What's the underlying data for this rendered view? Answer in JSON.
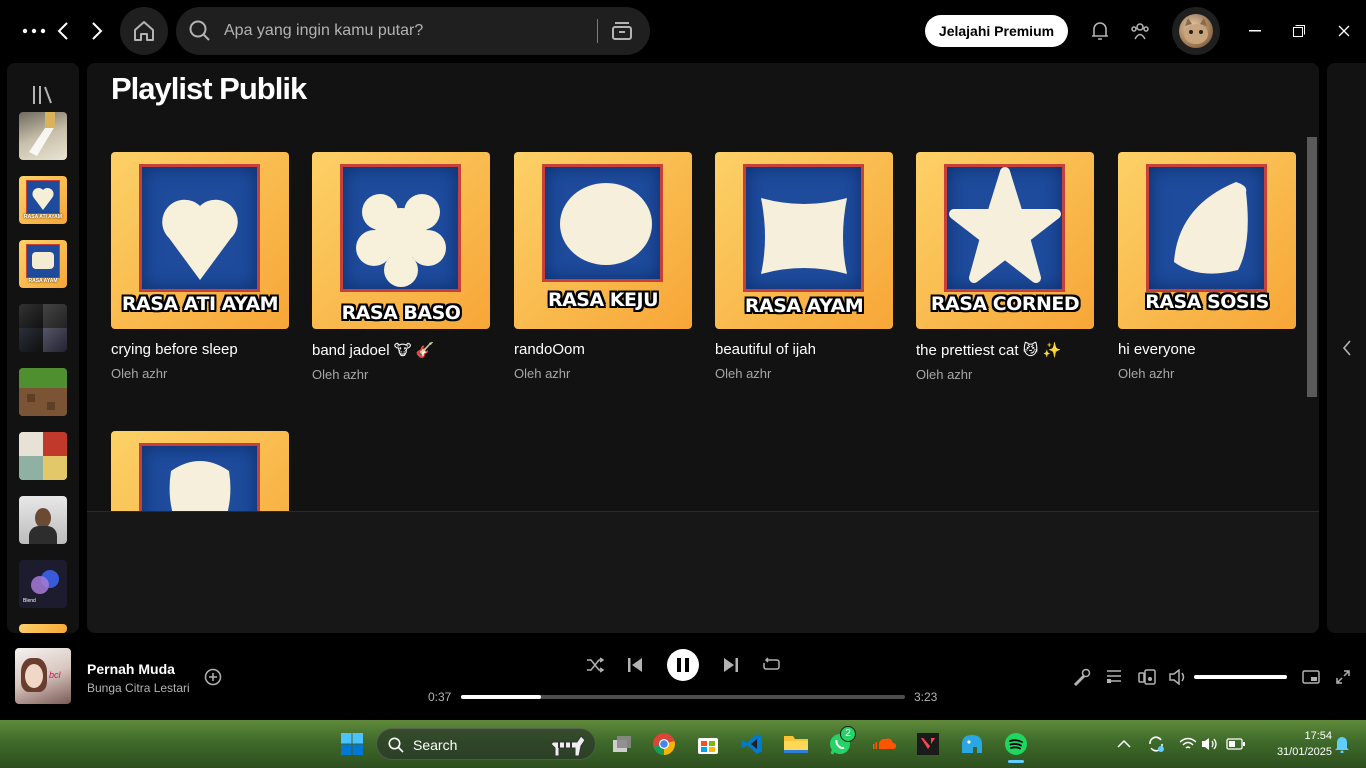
{
  "search": {
    "placeholder": "Apa yang ingin kamu putar?"
  },
  "header": {
    "premium_label": "Jelajahi Premium"
  },
  "section": {
    "title": "Playlist Publik"
  },
  "cards": [
    {
      "cover_label": "RASA ATI AYAM",
      "title": "crying before sleep",
      "owner": "Oleh azhr"
    },
    {
      "cover_label": "RASA BASO",
      "title": "band jadoel 🐮 🎸",
      "owner": "Oleh azhr"
    },
    {
      "cover_label": "RASA KEJU",
      "title": "randoOom",
      "owner": "Oleh azhr"
    },
    {
      "cover_label": "RASA AYAM",
      "title": "beautiful of ijah",
      "owner": "Oleh azhr"
    },
    {
      "cover_label": "RASA CORNED",
      "title": "the prettiest cat 😼 ✨",
      "owner": "Oleh azhr"
    },
    {
      "cover_label": "RASA SOSIS",
      "title": "hi everyone",
      "owner": "Oleh azhr"
    }
  ],
  "sidebar_thumbs": [
    "RASA ATI AYAM",
    "RASA AYAM",
    "Blend"
  ],
  "now_playing": {
    "title": "Pernah Muda",
    "artist": "Bunga Citra Lestari",
    "elapsed": "0:37",
    "duration": "3:23",
    "progress": 0.18,
    "volume": 1.0
  },
  "taskbar": {
    "search_label": "Search",
    "whatsapp_badge": "2",
    "time": "17:54",
    "date": "31/01/2025"
  },
  "colors": {
    "spotify_green": "#1ed760",
    "panel_bg": "#121212",
    "accent_white": "#ffffff"
  }
}
